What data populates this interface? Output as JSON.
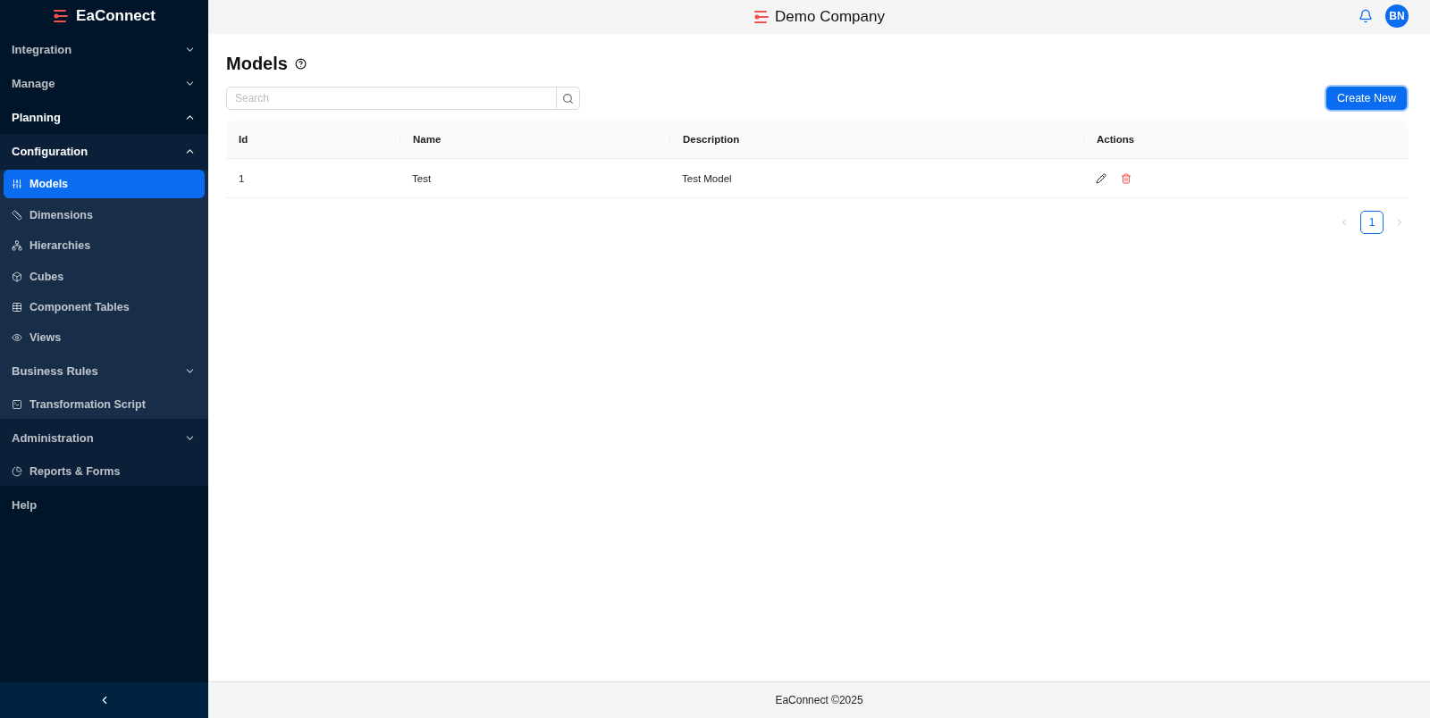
{
  "brand": {
    "name": "EaConnect"
  },
  "sidebar": {
    "items": [
      {
        "label": "Integration",
        "expanded": false
      },
      {
        "label": "Manage",
        "expanded": false
      },
      {
        "label": "Planning",
        "expanded": true,
        "children": [
          {
            "label": "Configuration",
            "expanded": true,
            "children": [
              {
                "label": "Models",
                "selected": true
              },
              {
                "label": "Dimensions",
                "selected": false
              },
              {
                "label": "Hierarchies",
                "selected": false
              },
              {
                "label": "Cubes",
                "selected": false
              },
              {
                "label": "Component Tables",
                "selected": false
              },
              {
                "label": "Views",
                "selected": false
              },
              {
                "label": "Business Rules",
                "expanded": false
              },
              {
                "label": "Transformation Script",
                "selected": false
              }
            ]
          },
          {
            "label": "Administration",
            "expanded": false
          },
          {
            "label": "Reports & Forms",
            "selected": false
          }
        ]
      },
      {
        "label": "Help",
        "selected": false
      }
    ]
  },
  "header": {
    "company": "Demo Company",
    "avatar": "BN"
  },
  "page": {
    "title": "Models",
    "search": {
      "placeholder": "Search"
    },
    "create_button": "Create New"
  },
  "table": {
    "columns": [
      "Id",
      "Name",
      "Description",
      "Actions"
    ],
    "rows": [
      {
        "id": "1",
        "name": "Test",
        "description": "Test Model"
      }
    ]
  },
  "pagination": {
    "pages": [
      {
        "label": "1",
        "selected": true
      }
    ]
  },
  "footer": "EaConnect ©2025"
}
